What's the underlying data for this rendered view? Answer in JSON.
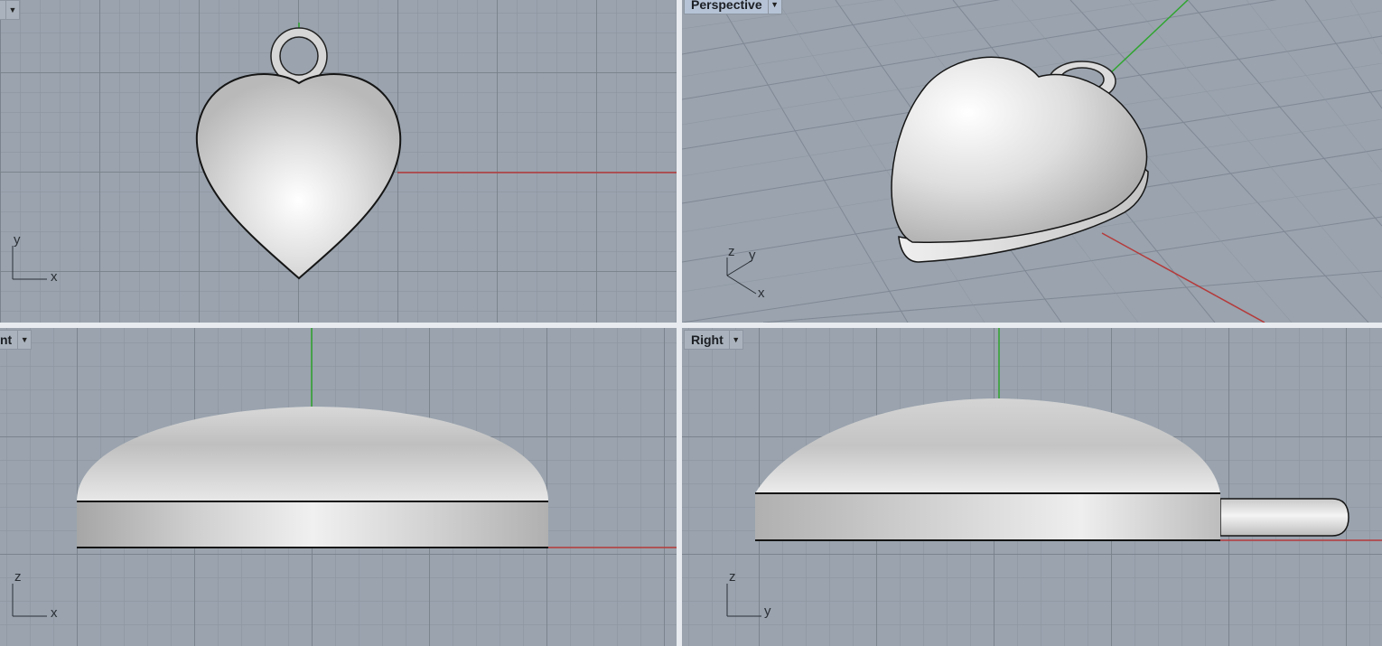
{
  "viewports": {
    "top": {
      "label": "",
      "axes": [
        "y",
        "x"
      ]
    },
    "persp": {
      "label": "Perspective",
      "axes": [
        "z",
        "y",
        "x"
      ]
    },
    "front": {
      "label": "nt",
      "axes": [
        "z",
        "x"
      ]
    },
    "right": {
      "label": "Right",
      "axes": [
        "z",
        "y"
      ]
    }
  },
  "colors": {
    "grid_bg": "#9aa3ae",
    "x_axis": "#b53a3a",
    "y_axis": "#2fa52f",
    "z_axis": "#2fa52f",
    "model": "#d4d4d4"
  },
  "icons": {
    "dropdown": "chevron-down-icon"
  }
}
